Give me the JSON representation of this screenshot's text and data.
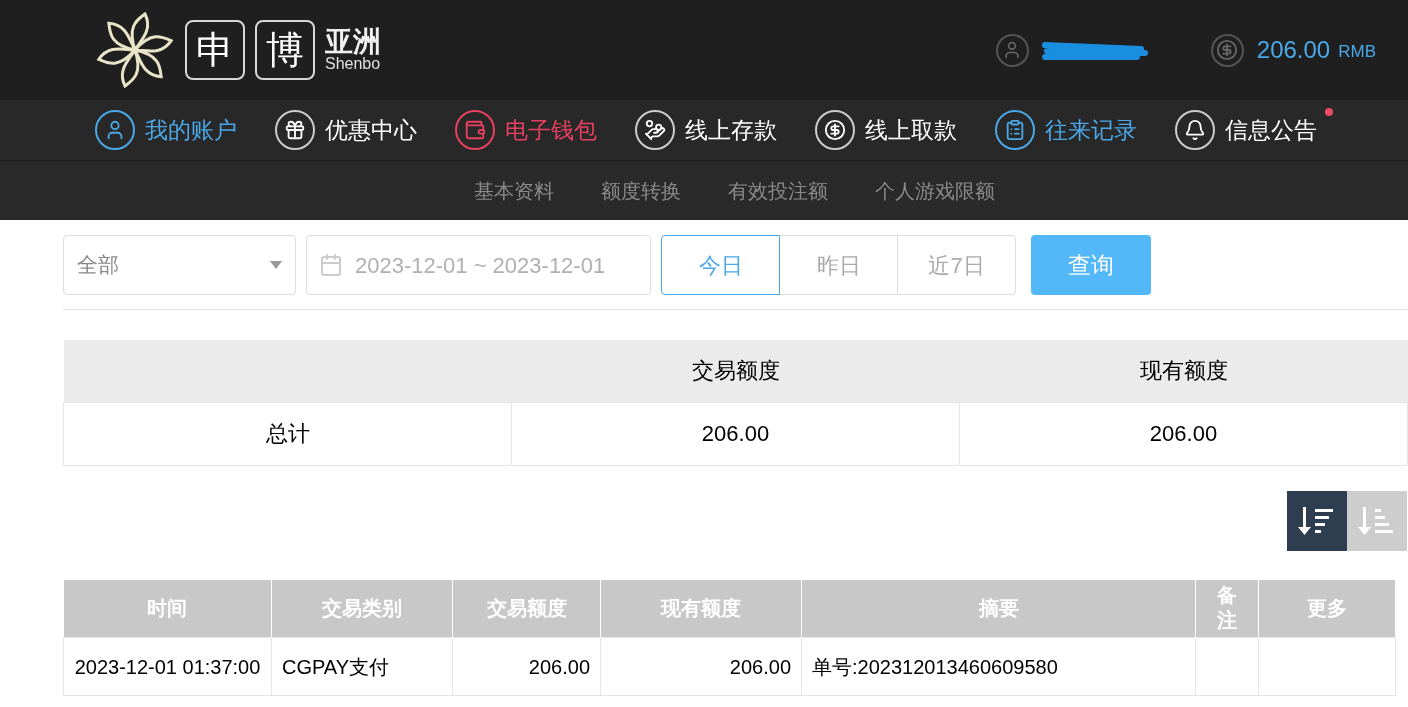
{
  "logo": {
    "boxed_chars": [
      "申",
      "博"
    ],
    "name": "亚洲",
    "latin": "Shenbo"
  },
  "account": {
    "balance": "206.00",
    "currency": "RMB"
  },
  "nav": [
    {
      "kind": "user",
      "label": "我的账户",
      "color": "#4aa8e8"
    },
    {
      "kind": "gift",
      "label": "优惠中心",
      "color": "#ffffff"
    },
    {
      "kind": "wallet",
      "label": "电子钱包",
      "color": "#e8405f"
    },
    {
      "kind": "deposit",
      "label": "线上存款",
      "color": "#ffffff"
    },
    {
      "kind": "withdraw",
      "label": "线上取款",
      "color": "#ffffff"
    },
    {
      "kind": "records",
      "label": "往来记录",
      "color": "#4aa8e8"
    },
    {
      "kind": "notice",
      "label": "信息公告",
      "color": "#ffffff",
      "unread": true
    }
  ],
  "subnav": [
    "基本资料",
    "额度转换",
    "有效投注额",
    "个人游戏限额"
  ],
  "filter": {
    "type": "全部",
    "date_range": "2023-12-01 ~ 2023-12-01",
    "quick": [
      {
        "label": "今日",
        "selected": true
      },
      {
        "label": "昨日",
        "selected": false
      },
      {
        "label": "近7日",
        "selected": false
      }
    ],
    "search_button": "查询"
  },
  "summary": {
    "columns": [
      "",
      "交易额度",
      "现有额度"
    ],
    "rows": [
      [
        "总计",
        "206.00",
        "206.00"
      ]
    ]
  },
  "sort": [
    {
      "kind": "desc",
      "selected": true
    },
    {
      "kind": "asc",
      "selected": false
    }
  ],
  "table": {
    "columns": [
      "时间",
      "交易类别",
      "交易额度",
      "现有额度",
      "摘要",
      "备注",
      "更多"
    ],
    "rows": [
      [
        "2023-12-01 01:37:00",
        "CGPAY支付",
        "206.00",
        "206.00",
        "单号:202312013460609580",
        "",
        ""
      ]
    ]
  }
}
